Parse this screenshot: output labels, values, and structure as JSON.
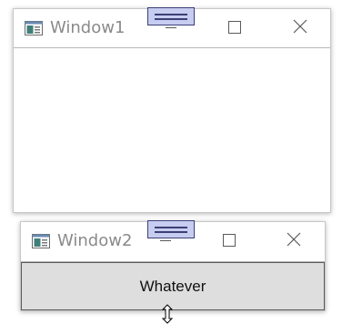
{
  "window1": {
    "title": "Window1",
    "icon": "app-window-icon"
  },
  "window2": {
    "title": "Window2",
    "icon": "app-window-icon",
    "button_label": "Whatever"
  },
  "controls": {
    "minimize_icon": "minimize-icon",
    "maximize_icon": "maximize-icon",
    "close_icon": "close-icon"
  },
  "drag_grip_icon": "drag-grip-icon",
  "cursor_icon": "resize-vertical-cursor-icon",
  "colors": {
    "grip_fill": "#c6cdf0",
    "grip_border": "#3b3f75",
    "button_fill": "#dedede",
    "title_text": "#8a8a8a"
  }
}
